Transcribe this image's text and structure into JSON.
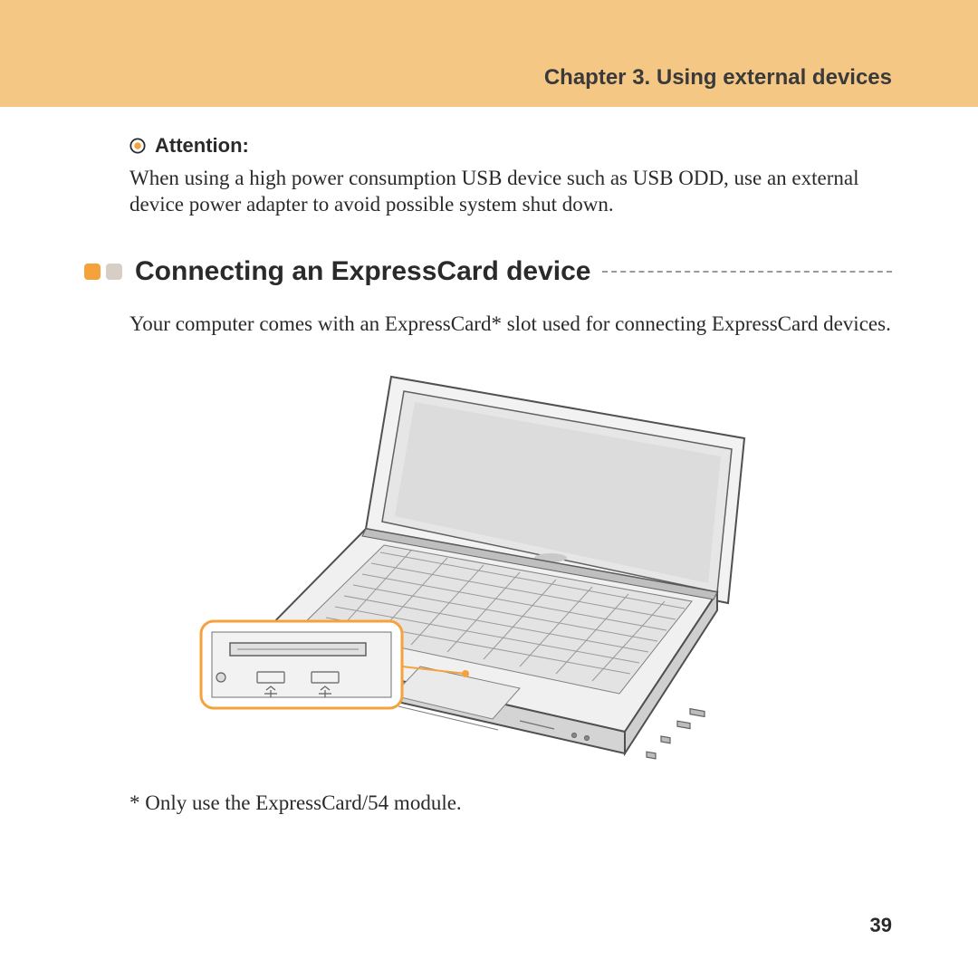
{
  "header": {
    "chapter": "Chapter 3. Using external devices"
  },
  "attention": {
    "label": "Attention:",
    "text": "When using a high power consumption USB device such as USB ODD, use an external device power adapter to avoid possible system shut down."
  },
  "section": {
    "heading": "Connecting an ExpressCard device",
    "intro": "Your computer comes with an ExpressCard* slot used for connecting ExpressCard devices.",
    "footnote": "* Only use the ExpressCard/54 module."
  },
  "page_number": "39"
}
